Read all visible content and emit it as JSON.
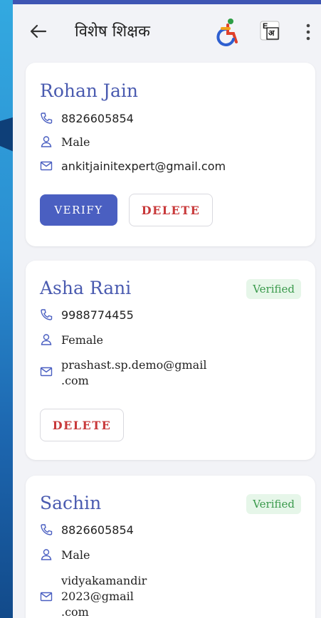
{
  "appbar": {
    "title": "विशेष शिक्षक",
    "lang_badge": "E",
    "lang_badge_sub": "अ"
  },
  "cards": [
    {
      "name": "Rohan Jain",
      "phone": "8826605854",
      "gender": "Male",
      "email": "ankitjainitexpert@gmail.com",
      "verify_label": "VERIFY",
      "delete_label": "DELETE"
    },
    {
      "name": "Asha Rani",
      "badge": "Verified",
      "phone": "9988774455",
      "gender": "Female",
      "email_line1": "prashast.sp.demo@gmail",
      "email_line2": ".com",
      "delete_label": "DELETE"
    },
    {
      "name": "Sachin",
      "badge": "Verified",
      "phone": "8826605854",
      "gender": "Male",
      "email_line1": "vidyakamandir",
      "email_line2": "2023@gmail",
      "email_line3": ".com"
    }
  ],
  "colors": {
    "accent": "#4a5fc1",
    "danger": "#c8393a",
    "success": "#3a9a4c",
    "bg": "#f2f3f7"
  }
}
